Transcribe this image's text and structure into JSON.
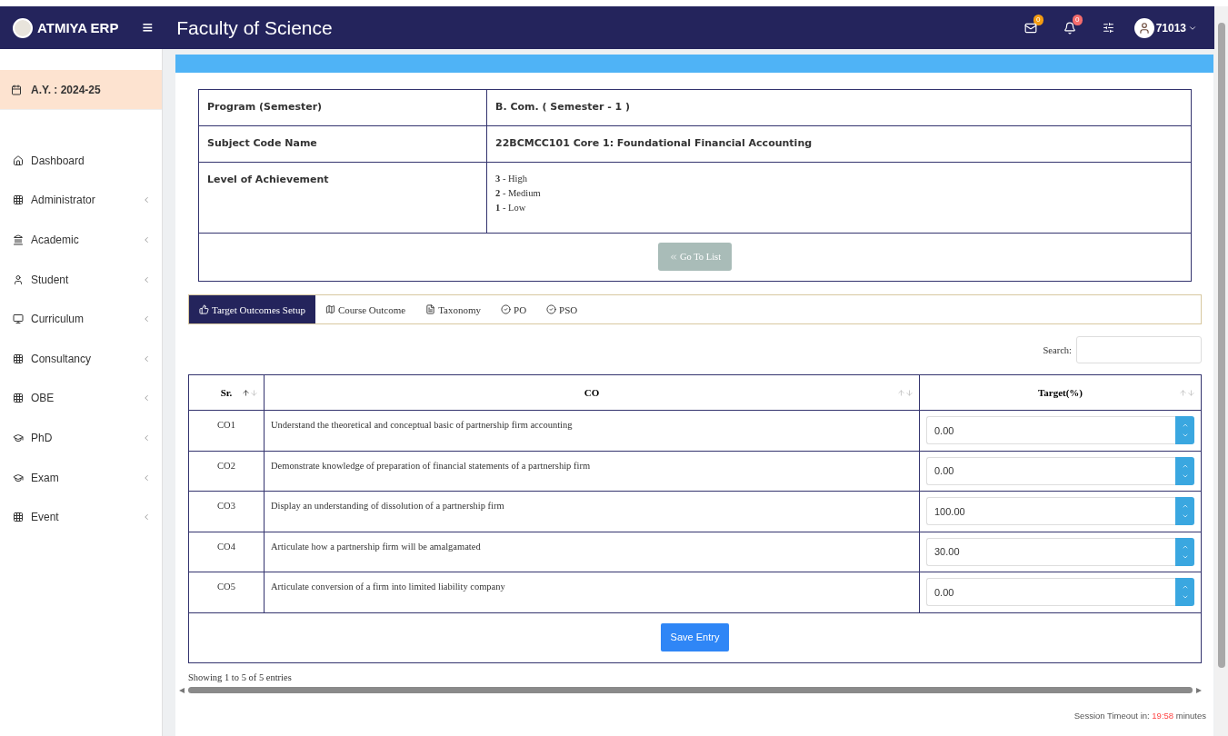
{
  "header": {
    "brand": "ATMIYA ERP",
    "menu_glyph": "≡",
    "title": "Faculty of Science",
    "mail_count": "0",
    "notification_count": "0",
    "user": "71013"
  },
  "sidebar": {
    "year": "A.Y. : 2024-25",
    "items": [
      {
        "label": "Dashboard",
        "expandable": false
      },
      {
        "label": "Administrator",
        "expandable": true
      },
      {
        "label": "Academic",
        "expandable": true
      },
      {
        "label": "Student",
        "expandable": true
      },
      {
        "label": "Curriculum",
        "expandable": true
      },
      {
        "label": "Consultancy",
        "expandable": true
      },
      {
        "label": "OBE",
        "expandable": true
      },
      {
        "label": "PhD",
        "expandable": true
      },
      {
        "label": "Exam",
        "expandable": true
      },
      {
        "label": "Event",
        "expandable": true
      }
    ]
  },
  "info": {
    "rows": [
      {
        "label": "Program (Semester)",
        "kind": "text",
        "value": "B. Com. ( Semester - 1 )"
      },
      {
        "label": "Subject Code Name",
        "kind": "text",
        "value": "22BCMCC101 Core 1: Foundational Financial Accounting"
      },
      {
        "label": "Level of Achievement",
        "kind": "levels",
        "levels": [
          {
            "number": "3",
            "name": "- High"
          },
          {
            "number": "2",
            "name": "- Medium"
          },
          {
            "number": "1",
            "name": "- Low"
          }
        ]
      }
    ],
    "button": {
      "label": "Go To List",
      "disabled": true
    }
  },
  "tabs": [
    {
      "label": "Target Outcomes Setup",
      "selected": true
    },
    {
      "label": "Course Outcome",
      "selected": false
    },
    {
      "label": "Taxonomy",
      "selected": false
    },
    {
      "label": "PO",
      "selected": false
    },
    {
      "label": "PSO",
      "selected": false
    }
  ],
  "search": {
    "label": "Search:"
  },
  "table": {
    "columns": [
      "Sr.",
      "CO",
      "Target(%)"
    ],
    "rows": [
      {
        "sr": "CO1",
        "co": "Understand the theoretical and conceptual basic of partnership firm accounting",
        "target": "0.00"
      },
      {
        "sr": "CO2",
        "co": "Demonstrate knowledge of preparation of financial statements of a partnership firm",
        "target": "0.00"
      },
      {
        "sr": "CO3",
        "co": "Display an understanding of dissolution of a partnership firm",
        "target": "100.00"
      },
      {
        "sr": "CO4",
        "co": "Articulate how a partnership firm will be amalgamated",
        "target": "30.00"
      },
      {
        "sr": "CO5",
        "co": "Articulate conversion of a firm into limited liability company",
        "target": "0.00"
      }
    ],
    "save_button": "Save Entry"
  },
  "footer": {
    "info": "Showing 1 to 5 of 5 entries",
    "session_label": "Session Timeout in:",
    "session_time": "19:58",
    "session_unit": "minutes"
  }
}
